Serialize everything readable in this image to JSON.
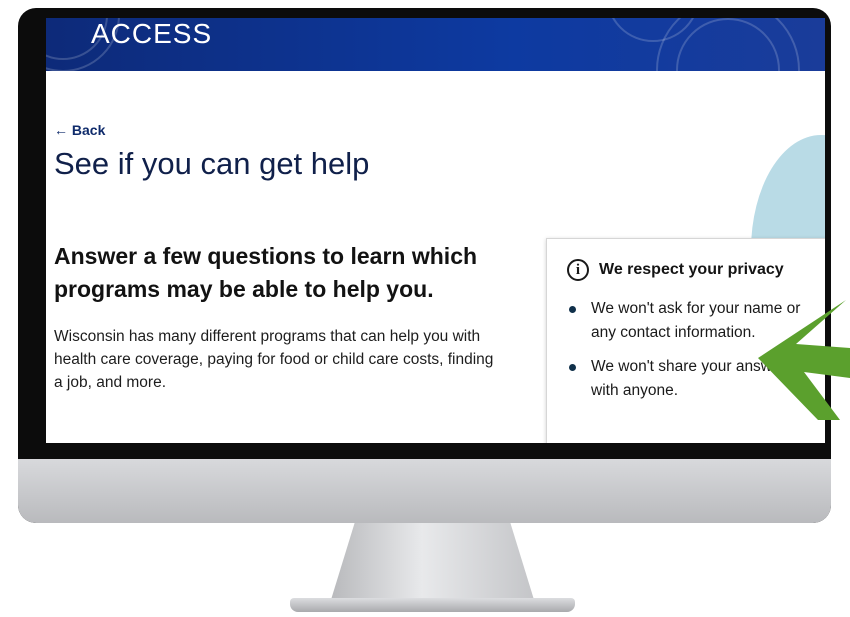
{
  "header": {
    "brand": "ACCESS"
  },
  "nav": {
    "back_label": "Back",
    "back_icon": "arrow-left-icon"
  },
  "page": {
    "title": "See if you can get help",
    "subhead": "Answer a few questions to learn which programs may be able to help you.",
    "description": "Wisconsin has many different programs that can help you with health care coverage, paying for food or child care costs, finding a job, and more."
  },
  "privacy": {
    "title": "We respect your privacy",
    "icon": "info-icon",
    "items": [
      {
        "text": "We won't ask for your name or any contact information."
      },
      {
        "text": "We won't share your answers with anyone."
      }
    ]
  },
  "colors": {
    "banner": "#0d3aa1",
    "accent_arrow": "#5ba02d",
    "text_dark": "#10204a",
    "decor_arc": "#b9dbe6"
  }
}
